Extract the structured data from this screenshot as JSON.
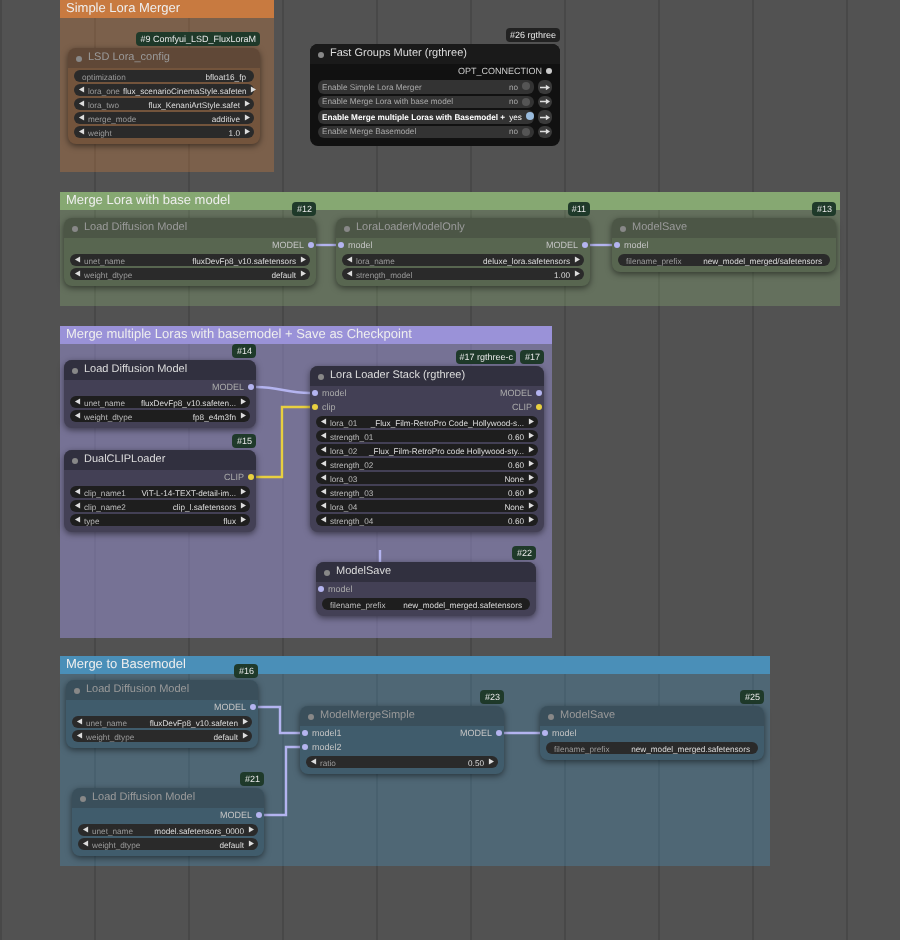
{
  "groups": [
    {
      "title": "Simple Lora Merger",
      "color": "#c87a40",
      "enabled": false,
      "nodes": [
        {
          "badges": [
            "#9 Comfyui_LSD_FluxLoraM"
          ],
          "title": "LSD Lora_config",
          "widgets": [
            {
              "kind": "text",
              "name": "optimization",
              "value": "bfloat16_fp"
            },
            {
              "kind": "combo",
              "name": "lora_one",
              "value": "flux_scenarioCinemaStyle.safeten"
            },
            {
              "kind": "combo",
              "name": "lora_two",
              "value": "flux_KenaniArtStyle.safet"
            },
            {
              "kind": "combo",
              "name": "merge_mode",
              "value": "additive"
            },
            {
              "kind": "combo",
              "name": "weight",
              "value": "1.0"
            }
          ]
        }
      ]
    },
    {
      "title": "Merge Lora with base model",
      "color": "#86a872",
      "enabled": false,
      "nodes": [
        {
          "badges": [
            "#12"
          ],
          "title": "Load Diffusion Model",
          "outputs": [
            {
              "label": "MODEL",
              "color": "#b4b4f0"
            }
          ],
          "widgets": [
            {
              "kind": "combo",
              "name": "unet_name",
              "value": "fluxDevFp8_v10.safetensors"
            },
            {
              "kind": "combo",
              "name": "weight_dtype",
              "value": "default"
            }
          ]
        },
        {
          "badges": [
            "#11"
          ],
          "title": "LoraLoaderModelOnly",
          "inputs": [
            {
              "label": "model",
              "color": "#b4b4f0"
            }
          ],
          "outputs": [
            {
              "label": "MODEL",
              "color": "#b4b4f0"
            }
          ],
          "widgets": [
            {
              "kind": "combo",
              "name": "lora_name",
              "value": "deluxe_lora.safetensors"
            },
            {
              "kind": "combo",
              "name": "strength_model",
              "value": "1.00"
            }
          ]
        },
        {
          "badges": [
            "#13"
          ],
          "title": "ModelSave",
          "inputs": [
            {
              "label": "model",
              "color": "#b4b4f0"
            }
          ],
          "widgets": [
            {
              "kind": "text",
              "name": "filename_prefix",
              "value": "new_model_merged/safetensors"
            }
          ]
        }
      ]
    },
    {
      "title": "Merge multiple Loras with basemodel + Save as Checkpoint",
      "color": "#9a92d8",
      "enabled": true,
      "nodes": [
        {
          "badges": [
            "#14"
          ],
          "title": "Load Diffusion Model",
          "outputs": [
            {
              "label": "MODEL",
              "color": "#b4b4f0"
            }
          ],
          "widgets": [
            {
              "kind": "combo",
              "name": "unet_name",
              "value": "fluxDevFp8_v10.safeten..."
            },
            {
              "kind": "combo",
              "name": "weight_dtype",
              "value": "fp8_e4m3fn"
            }
          ]
        },
        {
          "badges": [
            "#15"
          ],
          "title": "DualCLIPLoader",
          "outputs": [
            {
              "label": "CLIP",
              "color": "#e8d040"
            }
          ],
          "widgets": [
            {
              "kind": "combo",
              "name": "clip_name1",
              "value": "ViT-L-14-TEXT-detail-im..."
            },
            {
              "kind": "combo",
              "name": "clip_name2",
              "value": "clip_l.safetensors"
            },
            {
              "kind": "combo",
              "name": "type",
              "value": "flux"
            }
          ]
        },
        {
          "badges": [
            "#17 rgthree-c",
            "#17"
          ],
          "title": "Lora Loader Stack (rgthree)",
          "inputs": [
            {
              "label": "model",
              "color": "#b4b4f0"
            },
            {
              "label": "clip",
              "color": "#e8d040"
            }
          ],
          "outputs": [
            {
              "label": "MODEL",
              "color": "#b4b4f0"
            },
            {
              "label": "CLIP",
              "color": "#e8d040"
            }
          ],
          "widgets": [
            {
              "kind": "combo",
              "name": "lora_01",
              "value": "_Flux_Film-RetroPro Code_Hollywood-s..."
            },
            {
              "kind": "combo",
              "name": "strength_01",
              "value": "0.60"
            },
            {
              "kind": "combo",
              "name": "lora_02",
              "value": "_Flux_Film-RetroPro code Hollywood-sty..."
            },
            {
              "kind": "combo",
              "name": "strength_02",
              "value": "0.60"
            },
            {
              "kind": "combo",
              "name": "lora_03",
              "value": "None"
            },
            {
              "kind": "combo",
              "name": "strength_03",
              "value": "0.60"
            },
            {
              "kind": "combo",
              "name": "lora_04",
              "value": "None"
            },
            {
              "kind": "combo",
              "name": "strength_04",
              "value": "0.60"
            }
          ]
        },
        {
          "badges": [
            "#22"
          ],
          "title": "ModelSave",
          "inputs": [
            {
              "label": "model",
              "color": "#b4b4f0"
            }
          ],
          "widgets": [
            {
              "kind": "text",
              "name": "filename_prefix",
              "value": "new_model_merged.safetensors"
            }
          ]
        }
      ]
    },
    {
      "title": "Merge to Basemodel",
      "color": "#4a8fb8",
      "enabled": false,
      "nodes": [
        {
          "badges": [
            "#16"
          ],
          "title": "Load Diffusion Model",
          "outputs": [
            {
              "label": "MODEL",
              "color": "#b4b4f0"
            }
          ],
          "widgets": [
            {
              "kind": "combo",
              "name": "unet_name",
              "value": "fluxDevFp8_v10.safeten"
            },
            {
              "kind": "combo",
              "name": "weight_dtype",
              "value": "default"
            }
          ]
        },
        {
          "badges": [
            "#21"
          ],
          "title": "Load Diffusion Model",
          "outputs": [
            {
              "label": "MODEL",
              "color": "#b4b4f0"
            }
          ],
          "widgets": [
            {
              "kind": "combo",
              "name": "unet_name",
              "value": "model.safetensors_0000"
            },
            {
              "kind": "combo",
              "name": "weight_dtype",
              "value": "default"
            }
          ]
        },
        {
          "badges": [
            "#23"
          ],
          "title": "ModelMergeSimple",
          "inputs": [
            {
              "label": "model1",
              "color": "#b4b4f0"
            },
            {
              "label": "model2",
              "color": "#b4b4f0"
            }
          ],
          "outputs": [
            {
              "label": "MODEL",
              "color": "#b4b4f0"
            }
          ],
          "widgets": [
            {
              "kind": "combo",
              "name": "ratio",
              "value": "0.50"
            }
          ]
        },
        {
          "badges": [
            "#25"
          ],
          "title": "ModelSave",
          "inputs": [
            {
              "label": "model",
              "color": "#b4b4f0"
            }
          ],
          "widgets": [
            {
              "kind": "text",
              "name": "filename_prefix",
              "value": "new_model_merged.safetensors"
            }
          ]
        }
      ]
    }
  ],
  "muter": {
    "badge": "#26 rgthree",
    "title": "Fast Groups Muter (rgthree)",
    "output": "OPT_CONNECTION",
    "rows": [
      {
        "label": "Enable Simple Lora Merger",
        "value": "no",
        "on": false
      },
      {
        "label": "Enable Merge Lora with base model",
        "value": "no",
        "on": false
      },
      {
        "label": "Enable Merge multiple Loras with Basemodel +",
        "value": "yes",
        "on": true
      },
      {
        "label": "Enable Merge Basemodel",
        "value": "no",
        "on": false
      }
    ]
  }
}
